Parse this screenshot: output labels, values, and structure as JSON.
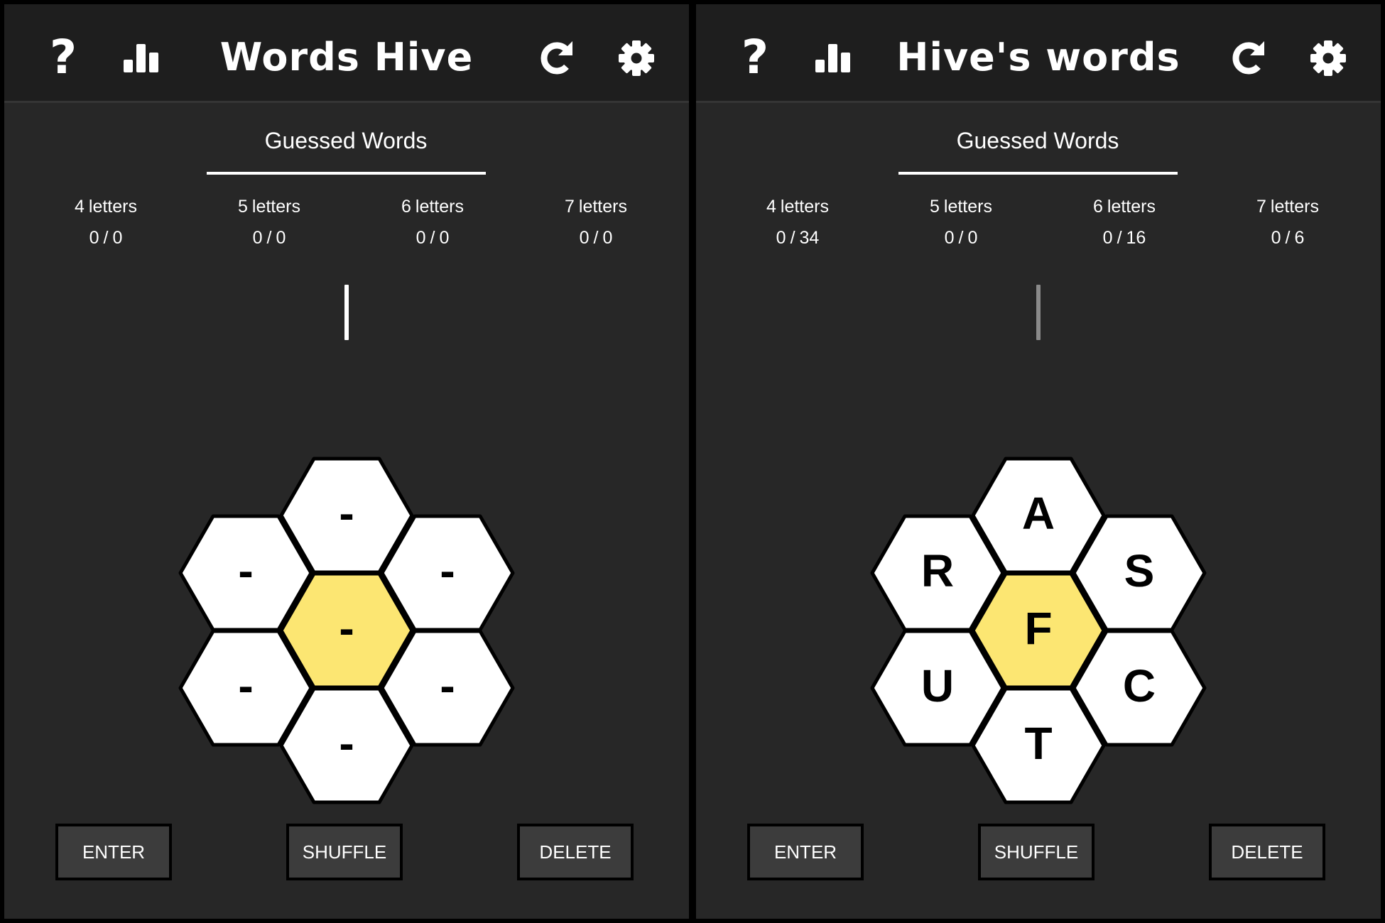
{
  "screens": [
    {
      "title": "Words Hive",
      "guessed_title": "Guessed Words",
      "counters": [
        {
          "num": "4",
          "unit": "letters",
          "found": "0",
          "sep": "/",
          "total": "0"
        },
        {
          "num": "5",
          "unit": "letters",
          "found": "0",
          "sep": "/",
          "total": "0"
        },
        {
          "num": "6",
          "unit": "letters",
          "found": "0",
          "sep": "/",
          "total": "0"
        },
        {
          "num": "7",
          "unit": "letters",
          "found": "0",
          "sep": "/",
          "total": "0"
        }
      ],
      "hive": {
        "center": "-",
        "outer": [
          "-",
          "-",
          "-",
          "-",
          "-",
          "-"
        ]
      },
      "buttons": {
        "enter": "ENTER",
        "shuffle": "SHUFFLE",
        "delete": "DELETE"
      }
    },
    {
      "title": "Hive's words",
      "guessed_title": "Guessed Words",
      "counters": [
        {
          "num": "4",
          "unit": "letters",
          "found": "0",
          "sep": "/",
          "total": "34"
        },
        {
          "num": "5",
          "unit": "letters",
          "found": "0",
          "sep": "/",
          "total": "0"
        },
        {
          "num": "6",
          "unit": "letters",
          "found": "0",
          "sep": "/",
          "total": "16"
        },
        {
          "num": "7",
          "unit": "letters",
          "found": "0",
          "sep": "/",
          "total": "6"
        }
      ],
      "hive": {
        "center": "F",
        "outer": [
          "A",
          "S",
          "C",
          "T",
          "U",
          "R"
        ]
      },
      "buttons": {
        "enter": "ENTER",
        "shuffle": "SHUFFLE",
        "delete": "DELETE"
      }
    }
  ],
  "icons": {
    "help": "help-icon",
    "stats": "stats-icon",
    "refresh": "refresh-icon",
    "settings": "gear-icon"
  },
  "colors": {
    "background": "#272727",
    "header": "#1e1e1e",
    "center_cell": "#fce672",
    "outer_cell": "#ffffff",
    "cell_border": "#000000",
    "button_bg": "#3c3c3c"
  }
}
